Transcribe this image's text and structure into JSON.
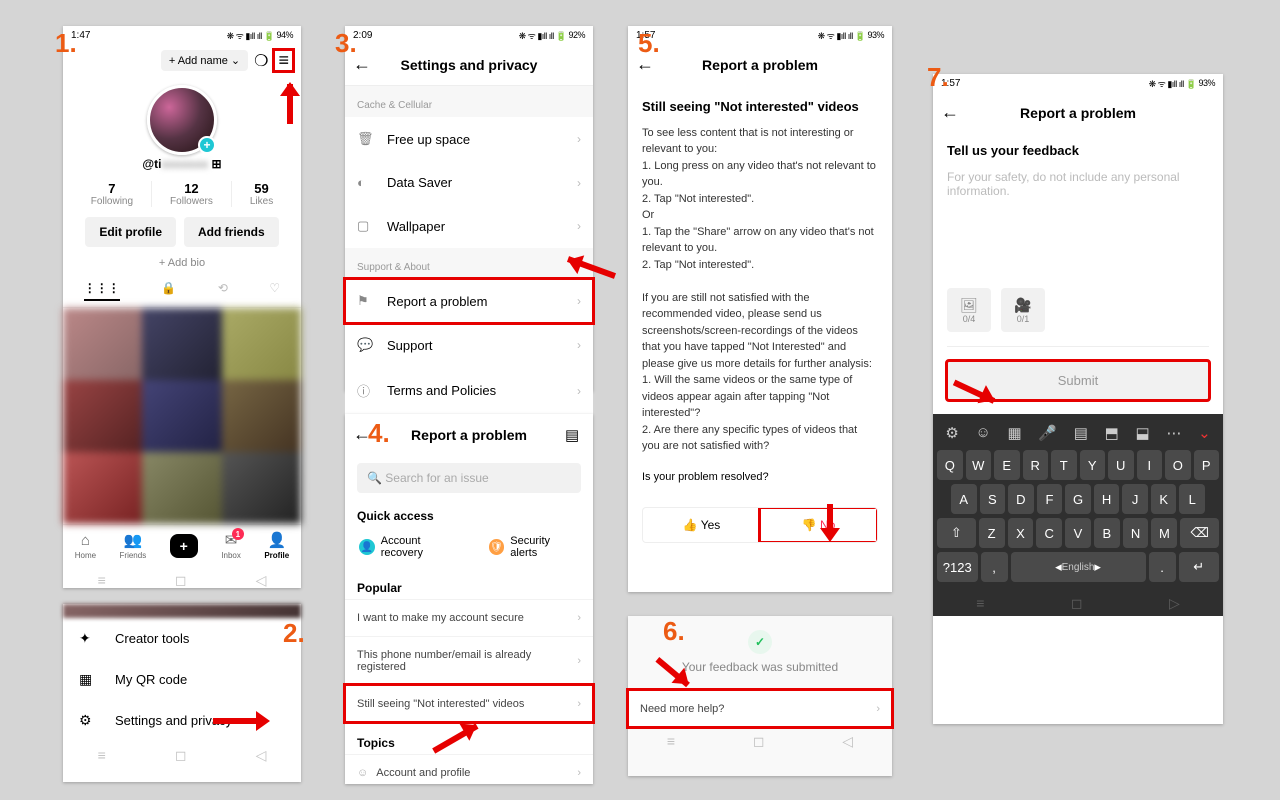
{
  "step_labels": [
    "1.",
    "2.",
    "3.",
    "4.",
    "5.",
    "6.",
    "7."
  ],
  "p1": {
    "time": "1:47",
    "battery": "94%",
    "add_name": "+ Add name",
    "handle": "@ti",
    "stats": [
      {
        "n": "7",
        "l": "Following"
      },
      {
        "n": "12",
        "l": "Followers"
      },
      {
        "n": "59",
        "l": "Likes"
      }
    ],
    "edit": "Edit profile",
    "addfriends": "Add friends",
    "addbio": "+ Add bio",
    "tabs": [
      "Home",
      "Friends",
      "",
      "Inbox",
      "Profile"
    ],
    "inbox_badge": "1"
  },
  "p2": {
    "rows": [
      "Creator tools",
      "My QR code",
      "Settings and privacy"
    ]
  },
  "p3": {
    "time": "2:09",
    "battery": "92%",
    "title": "Settings and privacy",
    "section1": "Cache & Cellular",
    "rows1": [
      "Free up space",
      "Data Saver",
      "Wallpaper"
    ],
    "section2": "Support & About",
    "rows2": [
      "Report a problem",
      "Support",
      "Terms and Policies"
    ]
  },
  "p4": {
    "title": "Report a problem",
    "search": "Search for an issue",
    "quickaccess": "Quick access",
    "qa1": "Account recovery",
    "qa2": "Security alerts",
    "popular": "Popular",
    "pop": [
      "I want to make my account secure",
      "This phone number/email is already registered",
      "Still seeing \"Not interested\" videos"
    ],
    "topics": "Topics",
    "topic1": "Account and profile"
  },
  "p5": {
    "time": "1:57",
    "battery": "93%",
    "title": "Report a problem",
    "heading": "Still seeing \"Not interested\" videos",
    "para1": "To see less content that is not interesting or relevant to you:",
    "l1": "1. Long press on any video that's not relevant to you.",
    "l2": "2. Tap \"Not interested\".",
    "or": "Or",
    "l3": "1. Tap the \"Share\" arrow on any video that's not relevant to you.",
    "l4": "2. Tap \"Not interested\".",
    "para2": "If you are still not satisfied with the recommended video, please send us screenshots/screen-recordings of the videos that you have tapped \"Not Interested\" and please give us more details for further analysis:",
    "q1": "1. Will the same videos or the same type of videos appear again after tapping \"Not interested\"?",
    "q2": "2. Are there any specific types of videos that you are not satisfied with?",
    "resolved": "Is your problem resolved?",
    "yes": "Yes",
    "no": "No"
  },
  "p6": {
    "msg": "Your feedback was submitted",
    "more": "Need more help?"
  },
  "p7": {
    "time": "1:57",
    "battery": "93%",
    "title": "Report a problem",
    "prompt": "Tell us your feedback",
    "placeholder": "For your safety, do not include any personal information.",
    "img_count": "0/4",
    "vid_count": "0/1",
    "submit": "Submit",
    "lang": "English",
    "krow1": [
      "Q",
      "W",
      "E",
      "R",
      "T",
      "Y",
      "U",
      "I",
      "O",
      "P"
    ],
    "krow2": [
      "A",
      "S",
      "D",
      "F",
      "G",
      "H",
      "J",
      "K",
      "L"
    ],
    "krow3": [
      "⇧",
      "Z",
      "X",
      "C",
      "V",
      "B",
      "N",
      "M",
      "⌫"
    ],
    "krow4": [
      "?123",
      ",",
      "."
    ]
  }
}
